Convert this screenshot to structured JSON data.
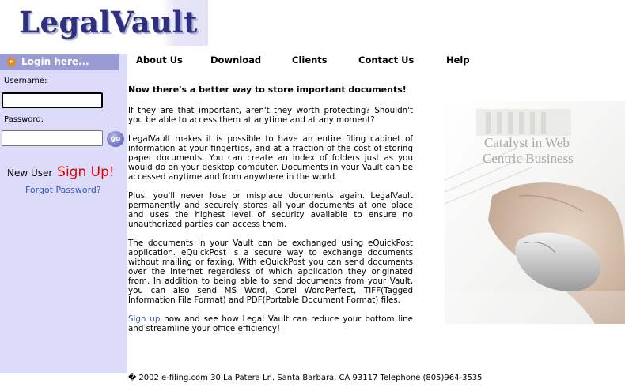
{
  "header": {
    "logo_text": "LegalVault"
  },
  "nav": {
    "items": [
      "About Us",
      "Download",
      "Clients",
      "Contact Us",
      "Help"
    ]
  },
  "sidebar": {
    "login_label": "Login here...",
    "username_label": "Username:",
    "password_label": "Password:",
    "username_value": "",
    "password_value": "",
    "go_label": "go",
    "new_user_label": "New User",
    "signup_label": "Sign Up!",
    "forgot_label": "Forgot Password?"
  },
  "content": {
    "headline": "Now there's a better way to store important documents!",
    "p1": "If they are that important, aren't they worth protecting? Shouldn't you be able to access them at anytime and at any moment?",
    "p2": "LegalVault makes it is possible to have an entire filing cabinet of information at your fingertips, and at a fraction of the cost of storing paper documents. You can create an index of folders just as you would do on your desktop computer. Documents in your Vault can be accessed anytime and from anywhere in the world.",
    "p3": "Plus, you'll never lose or misplace documents again. LegalVault permanently and securely stores all your documents at one place and uses the highest level of security available to ensure no unauthorized parties can access them.",
    "p4": "The documents in your Vault can be exchanged using eQuickPost application. eQuickPost is a secure way to exchange documents without mailing or faxing. With eQuickPost you can send documents over the Internet regardless of which application they originated from. In addition to being able to send documents from your Vault, you can also send MS Word, Corel WordPerfect, TIFF(Tagged Information File Format) and PDF(Portable Document Format) files.",
    "signup_link": "Sign up",
    "p5_rest": " now and see how Legal Vault can reduce your bottom line and streamline your office efficiency!"
  },
  "image": {
    "caption_line1": "Catalyst in Web",
    "caption_line2": "Centric Business"
  },
  "footer": {
    "text": "� 2002 e-filing.com 30 La Patera Ln. Santa Barbara, CA 93117 Telephone (805)964-3535"
  }
}
